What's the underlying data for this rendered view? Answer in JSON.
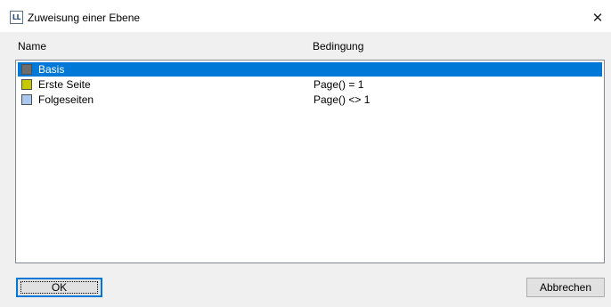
{
  "window": {
    "title": "Zuweisung einer Ebene",
    "icon": "LL-app-icon",
    "icon_text": "LL",
    "close_glyph": "✕"
  },
  "columns": {
    "name": "Name",
    "condition": "Bedingung"
  },
  "layers": [
    {
      "name": "Basis",
      "condition": "",
      "color": "#6d6d6d",
      "selected": true
    },
    {
      "name": "Erste Seite",
      "condition": "Page() = 1",
      "color": "#c8c800",
      "selected": false
    },
    {
      "name": "Folgeseiten",
      "condition": "Page() <> 1",
      "color": "#a8c8f0",
      "selected": false
    }
  ],
  "buttons": {
    "ok": "OK",
    "cancel": "Abbrechen"
  },
  "colors": {
    "selection": "#0078d7",
    "default_button_border": "#0078d7"
  }
}
